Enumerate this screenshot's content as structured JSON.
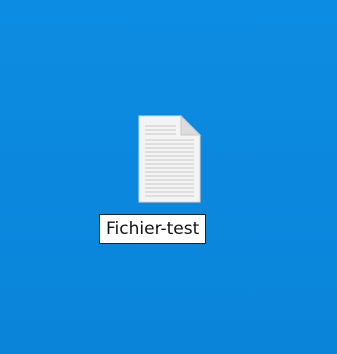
{
  "desktop": {
    "background_color": "#0b8ae0",
    "items": [
      {
        "icon": "text-file-icon",
        "label": "Fichier-test",
        "state": "renaming"
      }
    ]
  }
}
